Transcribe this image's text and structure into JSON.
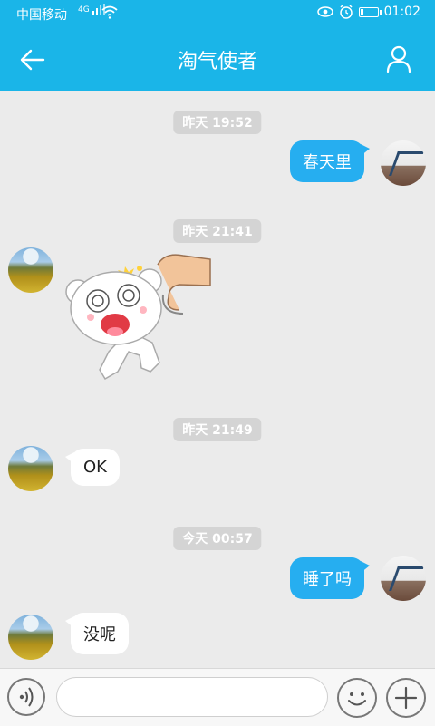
{
  "status_bar": {
    "carrier": "中国移动",
    "network": "4G",
    "time": "01:02",
    "battery_level": 0.2
  },
  "header": {
    "title": "淘气使者",
    "back_icon": "arrow-left-icon",
    "profile_icon": "person-icon"
  },
  "messages": [
    {
      "timestamp": "昨天 19:52",
      "sender": "self",
      "text": "春天里"
    },
    {
      "timestamp": "昨天 21:41",
      "sender": "other",
      "sticker": "bear-sticker"
    },
    {
      "timestamp": "昨天 21:49",
      "sender": "other",
      "text": "OK"
    },
    {
      "timestamp": "今天 00:57",
      "sender": "self",
      "text": "睡了吗"
    },
    {
      "sender": "other",
      "text": "没呢"
    }
  ],
  "input_bar": {
    "value": "",
    "voice_icon": "voice-icon",
    "emoji_icon": "smiley-icon",
    "plus_icon": "plus-icon"
  },
  "colors": {
    "accent": "#1ab5e8",
    "outgoing_bubble": "#26aef0",
    "incoming_bubble": "#ffffff",
    "chat_background": "#ebebeb",
    "timestamp_badge": "#d4d4d4"
  }
}
